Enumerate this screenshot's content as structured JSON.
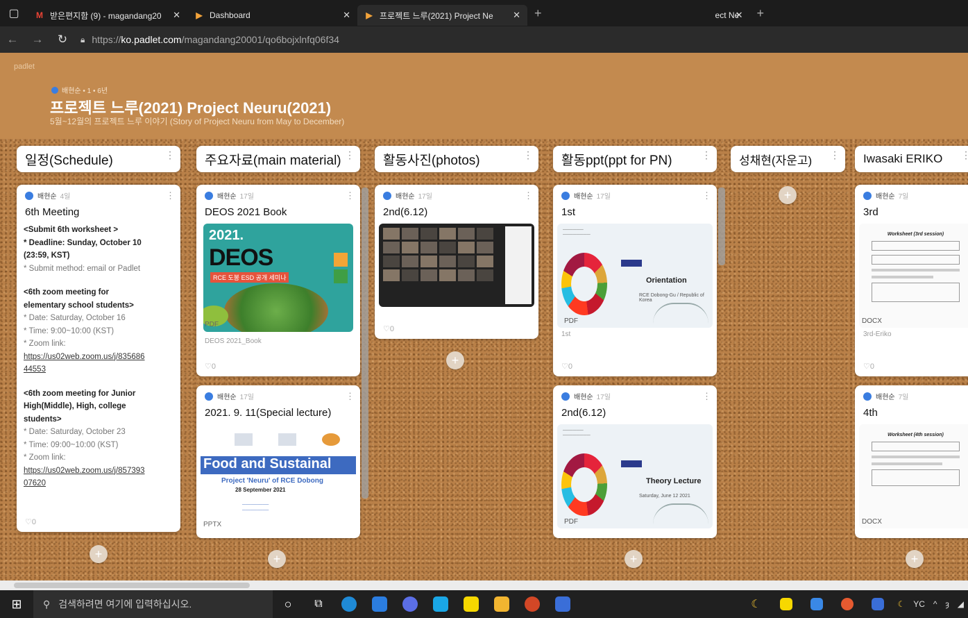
{
  "browser": {
    "tabs": [
      {
        "title": "받은편지함 (9) - magandang20",
        "icon": "gmail-icon"
      },
      {
        "title": "Dashboard",
        "icon": "padlet-icon"
      },
      {
        "title": "프로젝트 느루(2021) Project Ne",
        "icon": "padlet-icon"
      },
      {
        "title": "ect Ne",
        "icon": "padlet-icon"
      }
    ],
    "url_prefix": "https://",
    "url_host": "ko.padlet.com",
    "url_path": "/magandang20001/qo6bojxlnfq06f34"
  },
  "padlet": {
    "logo": "padlet",
    "owner": "배현순 • 1 • 6년",
    "title": "프로젝트 느루(2021) Project Neuru(2021)",
    "subtitle": "5월~12월의 프로젝트 느루 이야기 (Story of Project Neuru from May to December)"
  },
  "columns": [
    {
      "title": "일정(Schedule)"
    },
    {
      "title": "주요자료(main material)"
    },
    {
      "title": "활동사진(photos)"
    },
    {
      "title": "활동ppt(ppt for PN)"
    },
    {
      "title": "성채현(자운고)"
    },
    {
      "title": "Iwasaki ERIKO"
    }
  ],
  "posts": {
    "schedule": {
      "author": "배현순",
      "ago": "4일",
      "title": "6th Meeting",
      "lines": [
        "<Submit 6th worksheet >",
        "* Deadline: Sunday, October 10",
        "(23:59, KST)",
        "* Submit method: email or Padlet",
        "<6th zoom meeting for",
        "elementary school students>",
        "* Date: Saturday, October 16",
        "* Time: 9:00~10:00 (KST)",
        "* Zoom link:",
        "https://us02web.zoom.us/j/835686",
        "44553",
        "<6th zoom meeting for Junior",
        "High(Middle), High, college",
        "students>",
        "* Date: Saturday, October 23",
        "* Time: 09:00~10:00 (KST)",
        "* Zoom link:",
        "https://us02web.zoom.us/j/857393",
        "07620"
      ],
      "likes": "0"
    },
    "deos": {
      "author": "배현순",
      "ago": "17일",
      "title": "DEOS 2021 Book",
      "cover_year": "2021.",
      "cover_name": "DEOS",
      "cover_sub": "RCE 도봉 ESD 공개 세미나",
      "tag": "PDF",
      "caption": "DEOS 2021_Book",
      "likes": "0"
    },
    "lecture": {
      "author": "배현순",
      "ago": "17일",
      "title": "2021. 9. 11(Special lecture)",
      "banner": "Food and Sustainal",
      "project": "Project 'Neuru' of RCE Dobong",
      "date": "28 September 2021",
      "tag": "PPTX"
    },
    "photos": {
      "author": "배현순",
      "ago": "17일",
      "title": "2nd(6.12)",
      "likes": "0"
    },
    "ppt1": {
      "author": "배현순",
      "ago": "17일",
      "title": "1st",
      "slide_title": "Orientation",
      "slide_small": "RCE Dobong-Gu / Republic of Korea",
      "tag": "PDF",
      "caption": "1st",
      "likes": "0"
    },
    "ppt2": {
      "author": "배현순",
      "ago": "17일",
      "title": "2nd(6.12)",
      "slide_title": "Theory Lecture",
      "slide_small": "Saturday, June 12 2021",
      "tag": "PDF"
    },
    "eriko1": {
      "author": "배현순",
      "ago": "7일",
      "title": "3rd",
      "doc_title": "Worksheet (3rd session)",
      "tag": "DOCX",
      "caption": "3rd-Eriko",
      "likes": "0"
    },
    "eriko2": {
      "author": "배현순",
      "ago": "7일",
      "title": "4th",
      "doc_title": "Worksheet (4th session)",
      "tag": "DOCX"
    }
  },
  "taskbar": {
    "search_placeholder": "검색하려면 여기에 입력하십시오.",
    "sys_text": "YC"
  },
  "colors": {
    "header_bg": "#c38a4f",
    "cork": "#b98048",
    "accent_blue": "#3a7de0"
  }
}
